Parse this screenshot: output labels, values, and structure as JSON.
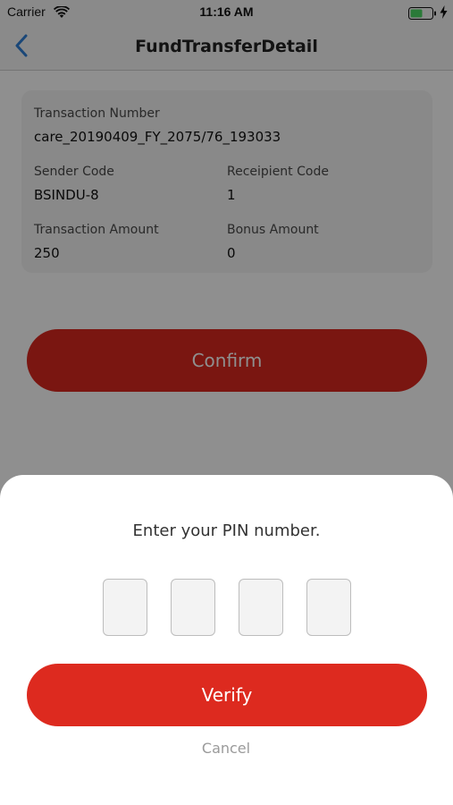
{
  "status_bar": {
    "carrier": "Carrier",
    "time": "11:16 AM",
    "battery_color": "#4cd964"
  },
  "nav": {
    "title": "FundTransferDetail",
    "back_icon": "chevron-left-icon",
    "tint_color": "#2f7fd6"
  },
  "transaction": {
    "number_label": "Transaction Number",
    "number_value": "care_20190409_FY_2075/76_193033",
    "sender_label": "Sender Code",
    "sender_value": "BSINDU-8",
    "recipient_label": "Receipient Code",
    "recipient_value": "1",
    "amount_label": "Transaction Amount",
    "amount_value": "250",
    "bonus_label": "Bonus Amount",
    "bonus_value": "0"
  },
  "actions": {
    "confirm_label": "Confirm",
    "accent_color": "#d9281f"
  },
  "pin_sheet": {
    "prompt": "Enter your PIN number.",
    "digit_count": 4,
    "verify_label": "Verify",
    "cancel_label": "Cancel"
  }
}
